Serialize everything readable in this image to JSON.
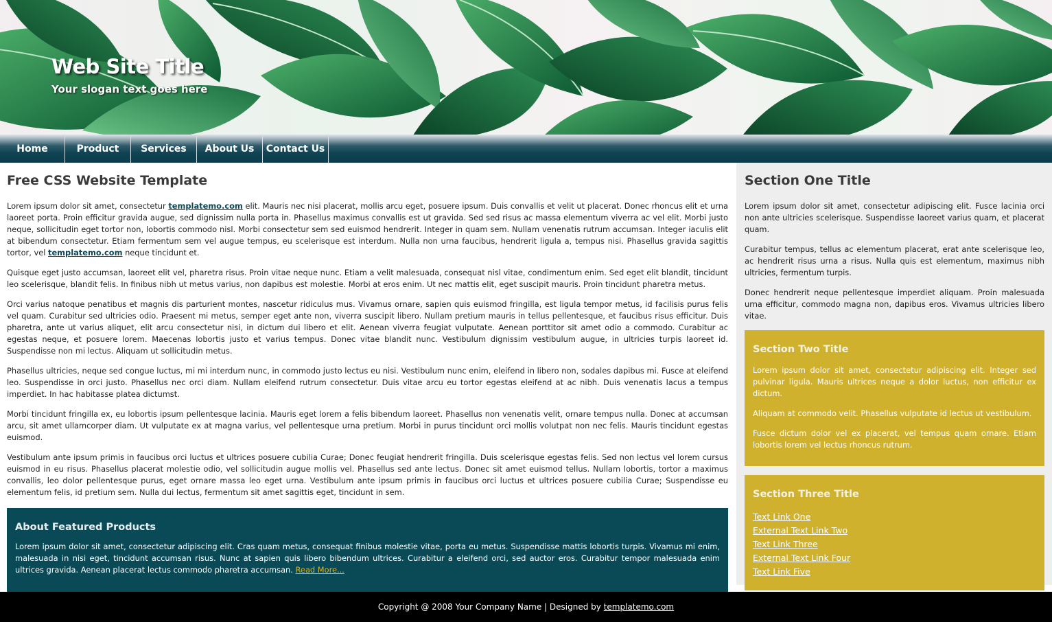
{
  "header": {
    "title": "Web Site Title",
    "slogan": "Your slogan text goes here",
    "background": "tropical-leaves-image"
  },
  "nav": {
    "items": [
      {
        "label": "Home"
      },
      {
        "label": "Product"
      },
      {
        "label": "Services"
      },
      {
        "label": "About Us"
      },
      {
        "label": "Contact Us"
      }
    ]
  },
  "main": {
    "title": "Free CSS Website Template",
    "p1": {
      "a": "Lorem ipsum dolor sit amet, consectetur ",
      "link1": "templatemo.com",
      "b": " elit. Mauris nec nisi placerat, mollis arcu eget, posuere ipsum. Duis convallis et velit ut placerat. Donec rhoncus elit et urna laoreet porta. Proin efficitur gravida augue, sed dignissim nulla porta in. Phasellus maximus convallis est ut gravida. Sed sed risus ac massa elementum viverra ac vel elit. Morbi justo neque, sollicitudin eget tortor non, lobortis commodo nisl. Morbi consectetur sem sed euismod hendrerit. Integer in quam sem. Nullam venenatis rutrum accumsan. Integer iaculis elit at bibendum consectetur. Etiam fermentum sem vel augue tempus, eu scelerisque est interdum. Nulla non urna faucibus, hendrerit ligula a, tempus nisi. Phasellus gravida sagittis tortor, vel ",
      "link2": "templatemo.com",
      "c": " neque tincidunt et."
    },
    "p2": "Quisque eget justo accumsan, laoreet elit vel, pharetra risus. Proin vitae neque nunc. Etiam a velit malesuada, consequat nisl vitae, condimentum enim. Sed eget elit blandit, tincidunt leo scelerisque, blandit felis. In finibus nibh ut metus varius, non dapibus est molestie. Morbi at eros enim. Ut nec mattis elit, eget suscipit mauris. Proin tincidunt pharetra metus.",
    "p3": "Orci varius natoque penatibus et magnis dis parturient montes, nascetur ridiculus mus. Vivamus ornare, sapien quis euismod fringilla, est ligula tempor metus, id facilisis purus felis vel quam. Curabitur sed ultricies odio. Praesent mi metus, semper eget ante non, viverra suscipit libero. Nullam pretium mauris in tellus pellentesque, et faucibus risus efficitur. Duis pharetra, ante ut varius aliquet, elit arcu consectetur nisi, in dictum dui libero et elit. Aenean viverra feugiat vulputate. Aenean porttitor sit amet odio a commodo. Curabitur ac egestas neque, et posuere lorem. Maecenas lobortis justo et varius tempus. Donec vitae blandit nunc. Vestibulum dignissim vestibulum augue, in ultricies turpis laoreet id. Suspendisse non mi lectus. Aliquam ut sollicitudin metus.",
    "p4": "Phasellus ultricies, neque sed congue luctus, mi mi interdum nunc, in commodo justo lectus eu nisi. Vestibulum nunc enim, eleifend in libero non, sodales dapibus mi. Fusce at eleifend leo. Suspendisse in orci justo. Phasellus nec orci diam. Nullam eleifend rutrum consectetur. Duis vitae arcu eu tortor egestas eleifend at ac nibh. Duis venenatis lacus a tempus imperdiet. In hac habitasse platea dictumst.",
    "p5": "Morbi tincidunt fringilla ex, eu lobortis ipsum pellentesque lacinia. Mauris eget lorem a felis bibendum laoreet. Phasellus non venenatis velit, ornare tempus nulla. Donec at accumsan arcu, sit amet ullamcorper diam. Ut vulputate ex at magna varius, vel pellentesque urna pretium. Morbi in purus tincidunt orci mollis volutpat non nec felis. Mauris tincidunt egestas euismod.",
    "p6": "Vestibulum ante ipsum primis in faucibus orci luctus et ultrices posuere cubilia Curae; Donec feugiat hendrerit fringilla. Duis scelerisque egestas felis. Sed non lectus vel lorem cursus euismod in eu risus. Phasellus placerat molestie odio, vel sollicitudin augue mollis vel. Phasellus sed ante lectus. Donec sit amet euismod tellus. Nullam lobortis, tortor a maximus convallis, leo dolor pellentesque purus, eget ornare massa leo eget urna. Vestibulum ante ipsum primis in faucibus orci luctus et ultrices posuere cubilia Curae; Suspendisse eu elementum felis, id pretium sem. Nulla dui lectus, fermentum sit amet sagittis eget, tincidunt in sem.",
    "featured": {
      "title": "About Featured Products",
      "text": "Lorem ipsum dolor sit amet, consectetur adipiscing elit. Cras quam metus, consequat finibus molestie vitae, porta eu metus. Suspendisse mattis lobortis turpis. Vivamus mi enim, malesuada in nisi eget, tincidunt accumsan risus. Nunc at sapien quis libero bibendum ultrices. Curabitur a eleifend orci, sed auctor eros. Curabitur tempor malesuada enim ultrices gravida. Aenean placerat lectus commodo pharetra accumsan. ",
      "read_more": "Read More..."
    }
  },
  "sidebar": {
    "section1": {
      "title": "Section One Title",
      "p1": "Lorem ipsum dolor sit amet, consectetur adipiscing elit. Fusce lacinia orci non ante ultricies scelerisque. Suspendisse laoreet varius quam, et placerat quam.",
      "p2": "Curabitur tempus, tellus ac elementum placerat, erat ante scelerisque leo, ac hendrerit risus urna a risus. Nulla quis est elementum, maximus nibh ultricies, fermentum turpis.",
      "p3": "Donec hendrerit neque pellentesque imperdiet aliquam. Proin malesuada urna efficitur, commodo magna non, dapibus eros. Vivamus ultricies libero vitae."
    },
    "section2": {
      "title": "Section Two Title",
      "p1": "Lorem ipsum dolor sit amet, consectetur adipiscing elit. Integer sed pulvinar ligula. Mauris ultrices neque a dolor luctus, non efficitur ex dictum.",
      "p2": "Aliquam at commodo velit. Phasellus vulputate id lectus ut vestibulum.",
      "p3": "Fusce dictum dolor vel ex placerat, vel tempus quam ornare. Etiam lobortis lorem vel lectus rhoncus rutrum."
    },
    "section3": {
      "title": "Section Three Title",
      "links": [
        {
          "label": "Text Link One"
        },
        {
          "label": "External Text Link Two"
        },
        {
          "label": "Text Link Three"
        },
        {
          "label": "External Text Link Four"
        },
        {
          "label": "Text Link Five"
        }
      ]
    }
  },
  "footer": {
    "text": "Copyright @ 2008 Your Company Name | Designed by ",
    "link": "templatemo.com"
  },
  "colors": {
    "nav_dark": "#0a3c4b",
    "featured_bg": "#0a4a57",
    "gold": "#cfb12e",
    "sidebar_bg": "#eeeeee",
    "footer_bg": "#000000"
  }
}
